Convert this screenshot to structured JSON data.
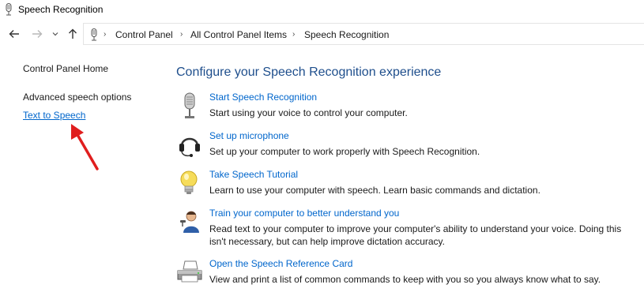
{
  "window": {
    "title": "Speech Recognition"
  },
  "breadcrumb": [
    "Control Panel",
    "All Control Panel Items",
    "Speech Recognition"
  ],
  "left_pane": {
    "home": "Control Panel Home",
    "advanced": "Advanced speech options",
    "tts": "Text to Speech"
  },
  "main": {
    "heading": "Configure your Speech Recognition experience",
    "tasks": [
      {
        "icon": "microphone-icon",
        "link": "Start Speech Recognition",
        "desc": "Start using your voice to control your computer."
      },
      {
        "icon": "headset-icon",
        "link": "Set up microphone",
        "desc": "Set up your computer to work properly with Speech Recognition."
      },
      {
        "icon": "lightbulb-icon",
        "link": "Take Speech Tutorial",
        "desc": "Learn to use your computer with speech.  Learn basic commands and dictation."
      },
      {
        "icon": "user-train-icon",
        "link": "Train your computer to better understand you",
        "desc": "Read text to your computer to improve your computer's ability to understand your voice.  Doing this isn't necessary, but can help improve dictation accuracy."
      },
      {
        "icon": "printer-icon",
        "link": "Open the Speech Reference Card",
        "desc": "View and print a list of common commands to keep with you so you always know what to say."
      }
    ]
  },
  "colors": {
    "link": "#0066cc",
    "heading": "#1e4e8c",
    "annotation_arrow": "#e01e1e"
  }
}
